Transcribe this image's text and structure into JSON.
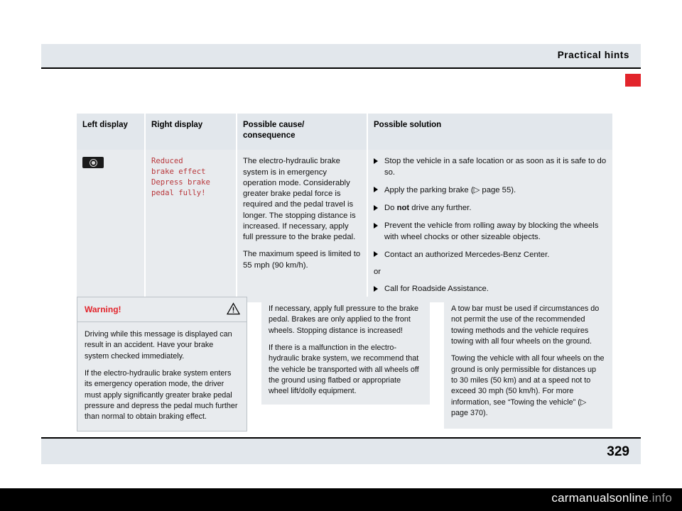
{
  "header": {
    "title": "Practical hints"
  },
  "footer": {
    "page_number": "329"
  },
  "table": {
    "headers": {
      "left_display": "Left display",
      "right_display": "Right display",
      "possible_cause": "Possible cause/\nconsequence",
      "possible_solution": "Possible solution"
    },
    "row": {
      "left_display_icon": "brake-warning-display-icon",
      "right_display_text": "Reduced\nbrake effect\nDepress brake\npedal fully!",
      "cause_paragraph_1": "The electro-hydraulic brake system is in emergency operation mode. Considerably greater brake pedal force is required and the pedal travel is longer. The stopping distance is increased. If necessary, apply full pressure to the brake pedal.",
      "cause_paragraph_2": "The maximum speed is limited to 55 mph (90 km/h).",
      "solutions": [
        "Stop the vehicle in a safe location or as soon as it is safe to do so.",
        "Apply the parking brake (▷ page 55).",
        "Do not drive any further.",
        "Prevent the vehicle from rolling away by blocking the wheels with wheel chocks or other sizeable objects.",
        "Contact an authorized Mercedes-Benz Center."
      ],
      "or_label": "or",
      "solution_alt": "Call for Roadside Assistance."
    }
  },
  "warning_box": {
    "title": "Warning!",
    "symbol": "warning-triangle-icon",
    "paragraph_1": "Driving while this message is displayed can result in an accident. Have your brake system checked immediately.",
    "paragraph_2": "If the electro-hydraulic brake system enters its emergency operation mode, the driver must apply significantly greater brake pedal pressure and depress the pedal much further than normal to obtain braking effect."
  },
  "note_box_2": {
    "paragraph_1": "If necessary, apply full pressure to the brake pedal. Brakes are only applied to the front wheels. Stopping distance is increased!",
    "paragraph_2": "If there is a malfunction in the electro-hydraulic brake system, we recommend that the vehicle be transported with all wheels off the ground using flatbed or appropriate wheel lift/dolly equipment."
  },
  "note_box_3": {
    "paragraph_1": "A tow bar must be used if circumstances do not permit the use of the recommended towing methods and the vehicle requires towing with all four wheels on the ground.",
    "paragraph_2": "Towing the vehicle with all four wheels on the ground is only permissible for distances up to 30 miles (50 km) and at a speed not to exceed 30 mph (50 km/h). For more information, see “Towing the vehicle” (▷ page 370)."
  },
  "watermark": {
    "text_main": "carmanualsonline",
    "text_dim": ".info"
  },
  "colors": {
    "accent_red": "#e2242b",
    "header_band": "#e2e7ec",
    "table_cell": "#e8ebee",
    "display_text": "#b8373b"
  }
}
